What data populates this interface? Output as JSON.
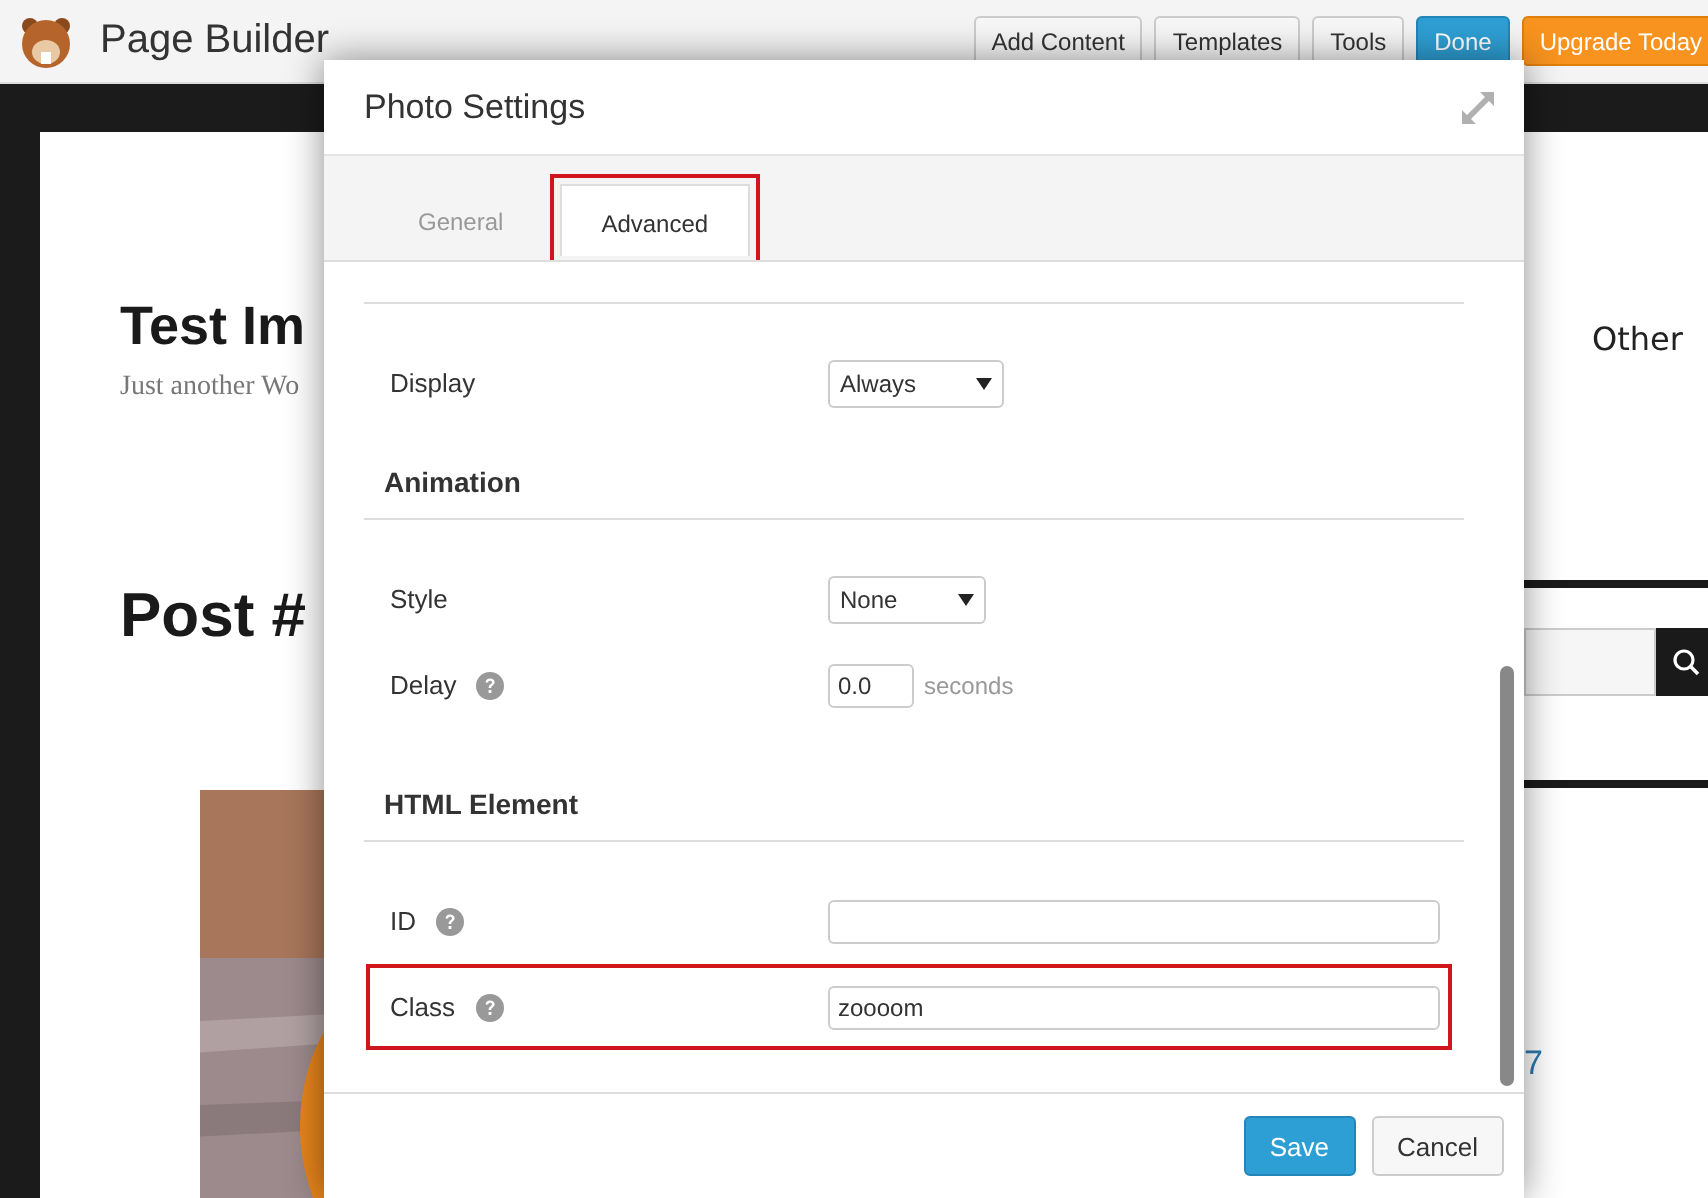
{
  "top_bar": {
    "title": "Page Builder",
    "buttons": [
      {
        "label": "Add Content",
        "kind": "default"
      },
      {
        "label": "Templates",
        "kind": "default"
      },
      {
        "label": "Tools",
        "kind": "default"
      },
      {
        "label": "Done",
        "kind": "primary"
      },
      {
        "label": "Upgrade Today",
        "kind": "upgrade"
      }
    ]
  },
  "background_page": {
    "site_title": "Test Im",
    "tagline": "Just another Wo",
    "post_title": "Post #",
    "menu_item": "Other",
    "link_text": "7"
  },
  "dialog": {
    "title": "Photo Settings",
    "tabs": [
      {
        "label": "General",
        "selected": false,
        "highlighted": false
      },
      {
        "label": "Advanced",
        "selected": true,
        "highlighted": true
      }
    ],
    "sections": [
      {
        "fields": [
          {
            "label": "Display",
            "kind": "select",
            "value": "Always",
            "help": false,
            "highlighted": false
          }
        ]
      },
      {
        "heading": "Animation",
        "fields": [
          {
            "label": "Style",
            "kind": "select",
            "value": "None",
            "help": false,
            "highlighted": false
          },
          {
            "label": "Delay",
            "kind": "number",
            "value": "0.0",
            "suffix": "seconds",
            "help": true,
            "highlighted": false
          }
        ]
      },
      {
        "heading": "HTML Element",
        "fields": [
          {
            "label": "ID",
            "kind": "text",
            "help": true,
            "highlighted": false
          },
          {
            "label": "Class",
            "kind": "text",
            "value": "zoooom",
            "help": true,
            "highlighted": true
          }
        ]
      }
    ],
    "buttons": [
      {
        "label": "Save",
        "kind": "primary"
      },
      {
        "label": "Cancel",
        "kind": "default"
      }
    ]
  }
}
